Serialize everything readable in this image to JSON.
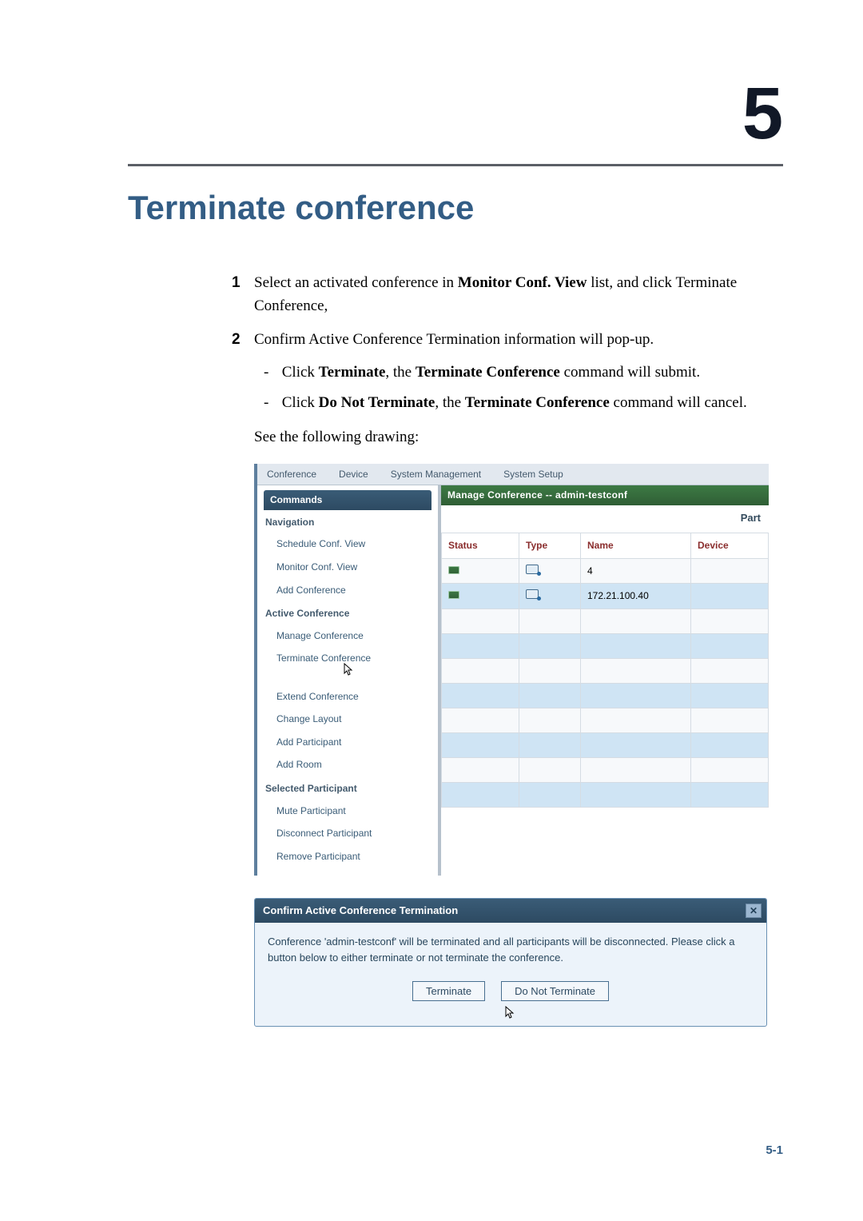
{
  "chapter": "5",
  "title": "Terminate conference",
  "steps": {
    "s1": {
      "num": "1",
      "text_a": "Select an activated conference in ",
      "bold": "Monitor Conf. View",
      "text_b": " list, and click Terminate Conference,"
    },
    "s2": {
      "num": "2",
      "text": "Confirm Active Conference Termination information will pop-up."
    }
  },
  "subs": {
    "a_pre": "Click ",
    "a_bold1": "Terminate",
    "a_mid": ", the ",
    "a_bold2": "Terminate Conference",
    "a_post": " command will submit.",
    "b_pre": "Click ",
    "b_bold1": "Do Not Terminate",
    "b_mid": ", the ",
    "b_bold2": "Terminate Conference",
    "b_post": " command will cancel."
  },
  "see": "See the following drawing:",
  "app": {
    "menubar": [
      "Conference",
      "Device",
      "System Management",
      "System Setup"
    ],
    "commands_hdr": "Commands",
    "nav_hdr": "Navigation",
    "nav": [
      "Schedule Conf. View",
      "Monitor Conf. View",
      "Add Conference"
    ],
    "active_hdr": "Active Conference",
    "active": [
      "Manage Conference",
      "Terminate Conference",
      "Extend Conference",
      "Change Layout",
      "Add Participant",
      "Add Room"
    ],
    "sel_hdr": "Selected Participant",
    "sel": [
      "Mute Participant",
      "Disconnect Participant",
      "Remove Participant"
    ],
    "content_hdr": "Manage Conference -- admin-testconf",
    "part_label": "Part",
    "cols": {
      "status": "Status",
      "type": "Type",
      "name": "Name",
      "device": "Device"
    },
    "rows": [
      {
        "name": "4"
      },
      {
        "name": "172.21.100.40"
      }
    ]
  },
  "dialog": {
    "title": "Confirm Active Conference Termination",
    "body": "Conference 'admin-testconf' will be terminated and all participants will be disconnected.  Please click a button below to either terminate or not terminate the conference.",
    "terminate": "Terminate",
    "dont": "Do Not Terminate",
    "x": "✕"
  },
  "footer": "5-1"
}
